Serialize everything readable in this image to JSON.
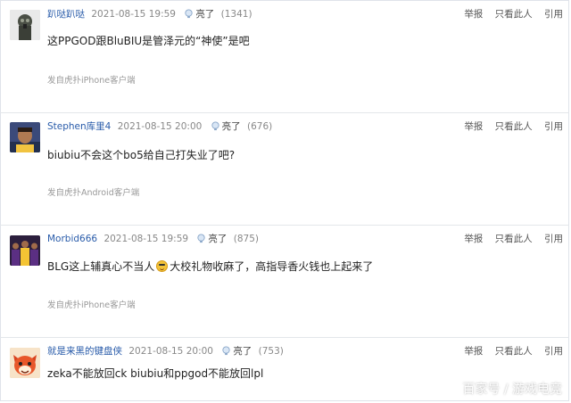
{
  "posts": [
    {
      "username": "趴哒趴哒",
      "time": "2021-08-15 19:59",
      "light_label": "亮了",
      "light_count": "(1341)",
      "content": "这PPGOD跟BluBIU是管泽元的“神使”是吧",
      "source": "发自虎扑iPhone客户端",
      "avatar_icon": "avatar-gas-mask"
    },
    {
      "username": "Stephen库里4",
      "time": "2021-08-15 20:00",
      "light_label": "亮了",
      "light_count": "(676)",
      "content": "biubiu不会这个bo5给自己打失业了吧?",
      "source": "发自虎扑Android客户端",
      "avatar_icon": "avatar-player-photo"
    },
    {
      "username": "Morbid666",
      "time": "2021-08-15 19:59",
      "light_label": "亮了",
      "light_count": "(875)",
      "content_before": "BLG这上辅真心不当人",
      "content_after": "大校礼物收麻了，高指导香火钱也上起来了",
      "source": "发自虎扑iPhone客户端",
      "avatar_icon": "avatar-team-photo"
    },
    {
      "username": "就是来黑的键盘侠",
      "time": "2021-08-15 20:00",
      "light_label": "亮了",
      "light_count": "(753)",
      "content": "zeka不能放回ck biubiu和ppgod不能放回lpl",
      "avatar_icon": "avatar-cartoon-fox"
    }
  ],
  "actions": {
    "report": "举报",
    "only_this": "只看此人",
    "quote": "引用"
  },
  "watermark": "百家号 / 游戏电竞",
  "colors": {
    "username": "#2a5caa",
    "divider": "#e3e6ea",
    "meta": "#888888"
  }
}
